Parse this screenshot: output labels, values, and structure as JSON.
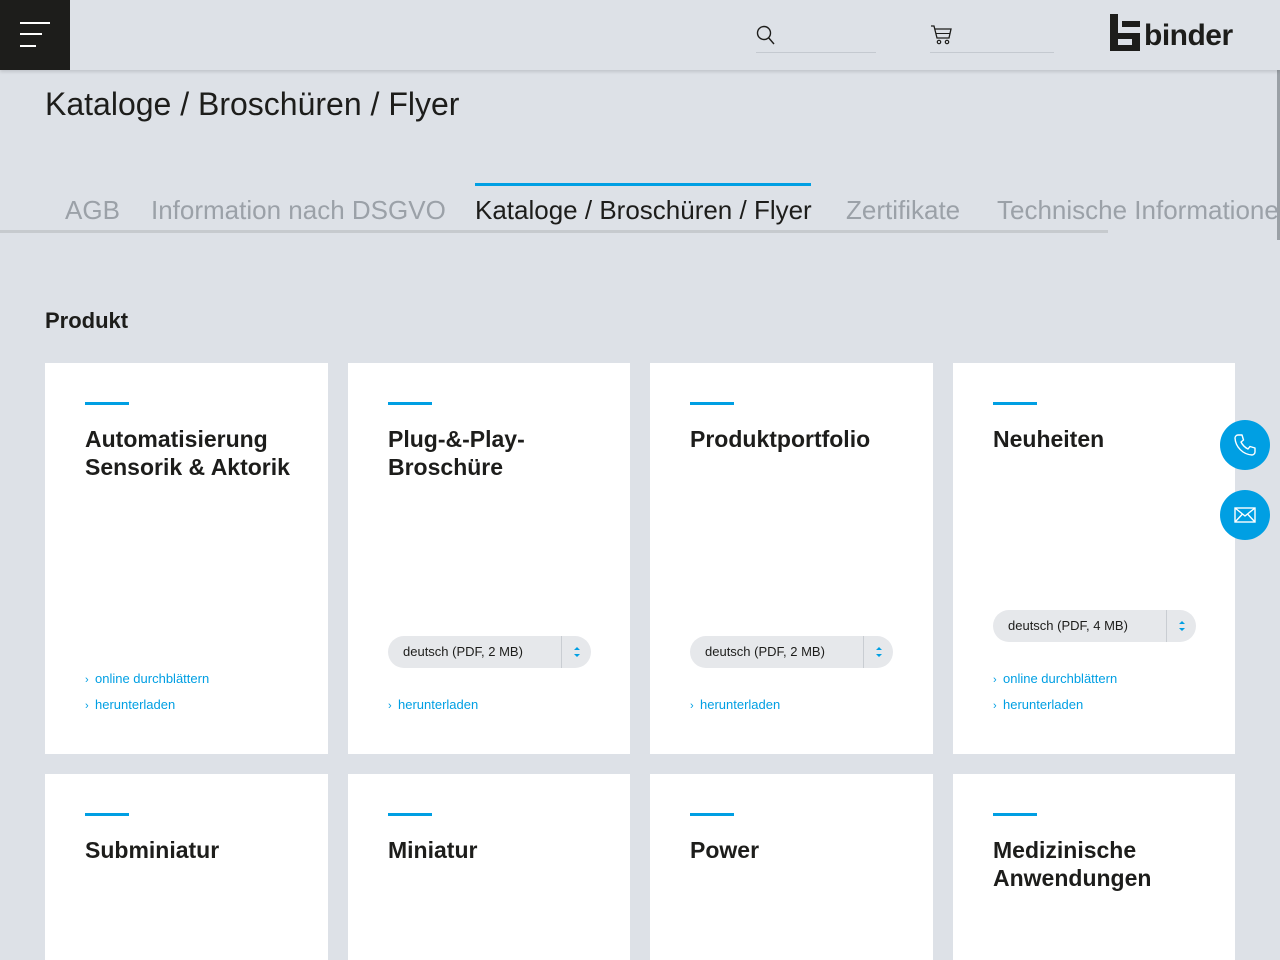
{
  "header": {
    "menu_icon": "hamburger-menu-icon",
    "search_icon": "search-icon",
    "cart_icon": "shopping-cart-icon",
    "logo_text": "binder"
  },
  "page_title": "Kataloge / Broschüren / Flyer",
  "tabs": [
    {
      "label": "AGB",
      "active": false
    },
    {
      "label": "Information nach DSGVO",
      "active": false
    },
    {
      "label": "Kataloge / Broschüren / Flyer",
      "active": true
    },
    {
      "label": "Zertifikate",
      "active": false
    },
    {
      "label": "Technische Informationen",
      "active": false
    }
  ],
  "section_title": "Produkt",
  "cards": [
    {
      "title": "Automatisierung Sensorik & Aktorik",
      "select": null,
      "links": [
        "online durchblättern",
        "herunterladen"
      ]
    },
    {
      "title": "Plug-&-Play-Broschüre",
      "select": "deutsch (PDF, 2 MB)",
      "links": [
        "herunterladen"
      ]
    },
    {
      "title": "Produktportfolio",
      "select": "deutsch (PDF, 2 MB)",
      "links": [
        "herunterladen"
      ]
    },
    {
      "title": "Neuheiten",
      "select": "deutsch (PDF, 4 MB)",
      "links": [
        "online durchblättern",
        "herunterladen"
      ]
    },
    {
      "title": "Subminiatur"
    },
    {
      "title": "Miniatur"
    },
    {
      "title": "Power"
    },
    {
      "title": "Medizinische Anwendungen"
    }
  ],
  "contact": {
    "phone_icon": "phone-icon",
    "mail_icon": "mail-icon"
  },
  "colors": {
    "accent": "#009fe3",
    "background": "#dde1e7",
    "text": "#1d1d1b",
    "inactive_tab": "#9ba1a8"
  }
}
